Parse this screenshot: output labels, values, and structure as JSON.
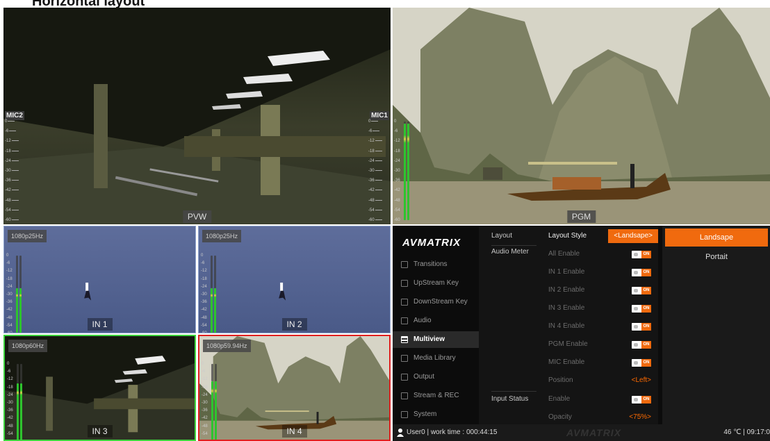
{
  "heading": "Horizontal layout",
  "monitors": {
    "pvw": {
      "label": "PVW",
      "mic_left": "MIC2",
      "mic_right": "MIC1"
    },
    "pgm": {
      "label": "PGM"
    },
    "meter_ticks": [
      "0",
      "-6",
      "-12",
      "-18",
      "-24",
      "-30",
      "-36",
      "-42",
      "-48",
      "-54",
      "-60"
    ],
    "inputs": [
      {
        "label": "IN 1",
        "resolution": "1080p25Hz",
        "level": 0.58
      },
      {
        "label": "IN 2",
        "resolution": "1080p25Hz",
        "level": 0.58
      },
      {
        "label": "IN 3",
        "resolution": "1080p60Hz",
        "level": 0.75
      },
      {
        "label": "IN 4",
        "resolution": "1080p59.94Hz",
        "level": 0.78
      }
    ],
    "colors": {
      "preview_border": "#3dd63d",
      "program_border": "#e02020",
      "meter_green": "#2ec32e",
      "meter_yellow": "#d7c94a"
    }
  },
  "menu": {
    "brand": "AVMATRIX",
    "nav": [
      {
        "label": "Transitions",
        "icon": "transitions-icon",
        "active": false
      },
      {
        "label": "UpStream Key",
        "icon": "upstream-key-icon",
        "active": false
      },
      {
        "label": "DownStream Key",
        "icon": "downstream-key-icon",
        "active": false
      },
      {
        "label": "Audio",
        "icon": "audio-icon",
        "active": false
      },
      {
        "label": "Multiview",
        "icon": "multiview-icon",
        "active": true
      },
      {
        "label": "Media Library",
        "icon": "media-library-icon",
        "active": false
      },
      {
        "label": "Output",
        "icon": "output-icon",
        "active": false
      },
      {
        "label": "Stream & REC",
        "icon": "stream-rec-icon",
        "active": false
      },
      {
        "label": "System",
        "icon": "gear-icon",
        "active": false
      }
    ],
    "settings": {
      "layout_category": "Layout",
      "layout_style_label": "Layout Style",
      "layout_style_value": "<Landsape>",
      "audio_meter_category": "Audio Meter",
      "toggle_on_text": "ON",
      "audio_rows": [
        "All Enable",
        "IN 1 Enable",
        "IN 2 Enable",
        "IN 3 Enable",
        "IN 4 Enable",
        "PGM Enable",
        "MIC Enable"
      ],
      "position_label": "Position",
      "position_value": "<Left>",
      "input_status_category": "Input Status",
      "enable_label": "Enable",
      "opacity_label": "Opacity",
      "opacity_value": "<75%>"
    },
    "options": [
      "Landsape",
      "Portait"
    ],
    "selected_option": "Landsape",
    "accent": "#f06a0e"
  },
  "status": {
    "user": "User0 | work time : 000:44:15",
    "watermark": "AVMATRIX",
    "right": "46 ℃ | 09:17:0"
  }
}
